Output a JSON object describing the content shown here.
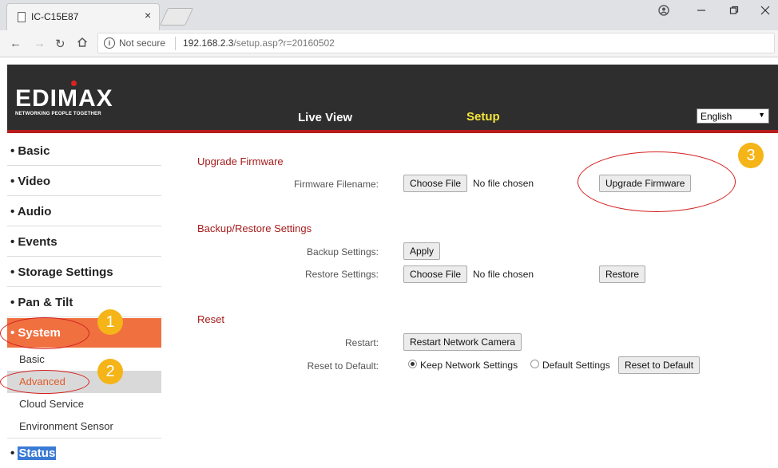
{
  "browser": {
    "tab_title": "IC-C15E87",
    "tab_close": "×",
    "security_label": "Not secure",
    "url_host": "192.168.2.3",
    "url_path": "/setup.asp?r=20160502"
  },
  "header": {
    "logo_text": "EDIMAX",
    "logo_tagline": "NETWORKING PEOPLE TOGETHER",
    "nav": {
      "live_view": "Live View",
      "setup": "Setup"
    },
    "language": "English"
  },
  "sidebar": {
    "items": [
      {
        "label": "• Basic"
      },
      {
        "label": "• Video"
      },
      {
        "label": "• Audio"
      },
      {
        "label": "• Events"
      },
      {
        "label": "• Storage Settings"
      },
      {
        "label": "• Pan & Tilt"
      },
      {
        "label": "• System"
      }
    ],
    "system_sub": [
      {
        "label": "Basic"
      },
      {
        "label": "Advanced"
      },
      {
        "label": "Cloud Service"
      },
      {
        "label": "Environment Sensor"
      }
    ],
    "status_bullet": "•",
    "status_label": "Status"
  },
  "upgrade": {
    "title": "Upgrade Firmware",
    "filename_label": "Firmware Filename:",
    "choose_file": "Choose File",
    "no_file": "No file chosen",
    "upgrade_button": "Upgrade Firmware"
  },
  "backup": {
    "title": "Backup/Restore Settings",
    "backup_label": "Backup Settings:",
    "apply_button": "Apply",
    "restore_label": "Restore Settings:",
    "choose_file": "Choose File",
    "no_file": "No file chosen",
    "restore_button": "Restore"
  },
  "reset": {
    "title": "Reset",
    "restart_label": "Restart:",
    "restart_button": "Restart Network Camera",
    "reset_label": "Reset to Default:",
    "keep_option": "Keep Network Settings",
    "default_option": "Default Settings",
    "reset_button": "Reset to Default"
  },
  "annotations": {
    "m1": "1",
    "m2": "2",
    "m3": "3"
  },
  "colors": {
    "accent": "#f07040",
    "header_bg": "#2e2e2e",
    "header_stripe": "#b81c1c",
    "section_title": "#a51c1c",
    "marker": "#f5b417",
    "ring": "#d42020"
  }
}
